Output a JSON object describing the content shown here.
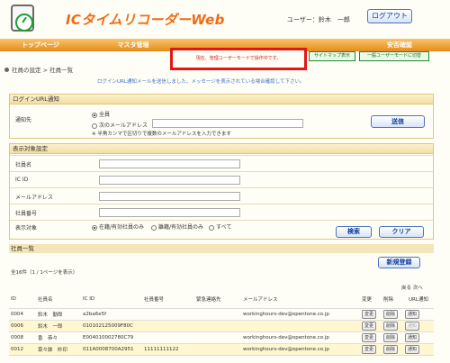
{
  "header": {
    "app_title": "ICタイムリコーダーWeb",
    "user_label": "ユーザー：鈴木　一郎",
    "logout_label": "ログアウト"
  },
  "nav": {
    "items": [
      {
        "label": "トップページ"
      },
      {
        "label": "マスタ管理"
      },
      {
        "label": ""
      },
      {
        "label": "安否確認"
      }
    ]
  },
  "popup": {
    "message": "現在、管理ユーザーモードで操作中です。"
  },
  "mode_buttons": {
    "sitemap_label": "サイトマップ表示",
    "user_mode_label": "一般ユーザーモードに切替"
  },
  "breadcrumb": "社員の設定 > 社員一覧",
  "notice": "ログインURL通知メールを送信しました。メッセージを表示されている場合確認して下さい。",
  "login_panel": {
    "title": "ログインURL通知",
    "label": "通知先",
    "option_all": "全員",
    "option_address": "次のメールアドレス",
    "hint": "※ 半角カンマで区切りで複数のメールアドレスを入力できます",
    "send_label": "送信"
  },
  "filter_panel": {
    "title": "表示対象設定",
    "fields": [
      {
        "label": "社員名"
      },
      {
        "label": "IC ID"
      },
      {
        "label": "メールアドレス"
      },
      {
        "label": "社員番号"
      }
    ],
    "display_label": "表示対象",
    "display_options": [
      {
        "label": "在籍/有効社員のみ",
        "selected": true
      },
      {
        "label": "離籍/有効社員のみ",
        "selected": false
      },
      {
        "label": "すべて",
        "selected": false
      }
    ],
    "search_label": "検索",
    "clear_label": "クリア"
  },
  "employee_list": {
    "title": "社員一覧",
    "new_label": "新規登録",
    "count": "全16件（1 / 1ページを表示）",
    "paging": "戻る 次へ",
    "columns": [
      "ID",
      "社員名",
      "IC ID",
      "社員番号",
      "緊急連絡先",
      "メールアドレス",
      "変更",
      "削除",
      "URL通知"
    ],
    "rows": [
      {
        "id": "0004",
        "name": "鈴木　勤郎",
        "ic_id": "a2ba6e5f",
        "number": "",
        "emergency": "",
        "email": "workinghours-dev@opentone.co.jp",
        "edit": "変更",
        "delete": "削除",
        "notify": "通知"
      },
      {
        "id": "0006",
        "name": "鈴木　一郎",
        "ic_id": "010102125009F80C",
        "number": "",
        "emergency": "",
        "email": "",
        "edit": "変更",
        "delete": "削除",
        "notify": "通知"
      },
      {
        "id": "0008",
        "name": "香　恭々",
        "ic_id": "E004010002780C79",
        "number": "",
        "emergency": "",
        "email": "workinghours-dev@opentone.co.jp",
        "edit": "変更",
        "delete": "削除",
        "notify": "通知"
      },
      {
        "id": "0012",
        "name": "菜々鉢　紗印",
        "ic_id": "011A0008700A2951",
        "number": "11111111122",
        "emergency": "",
        "email": "workinghours-dev@opentone.co.jp",
        "edit": "変更",
        "delete": "削除",
        "notify": "通知"
      }
    ]
  }
}
